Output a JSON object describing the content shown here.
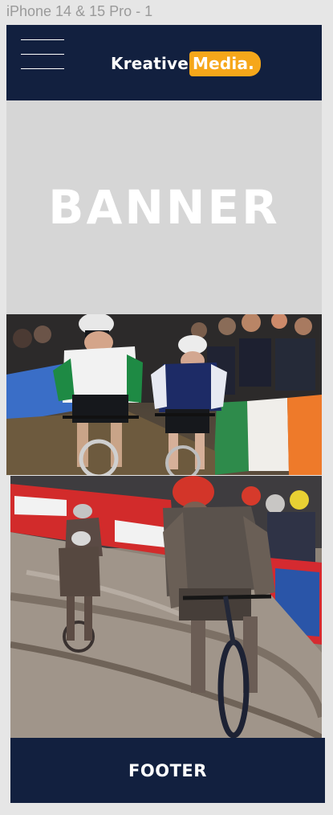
{
  "frame": {
    "label": "iPhone 14 & 15 Pro - 1"
  },
  "header": {
    "logo_primary": "Kreative",
    "logo_accent": "Media.",
    "menu_icon": "hamburger-menu-icon",
    "background_color": "#12203f",
    "accent_color": "#f6a71a"
  },
  "banner": {
    "text": "BANNER",
    "background_color": "#d6d6d6"
  },
  "photos": [
    {
      "name": "cyclocross-race-photo",
      "subject": "two cyclists riding past crowd with Italian flag"
    },
    {
      "name": "muddy-cyclist-photo",
      "subject": "muddy cyclist descending beside Bingoal barriers"
    }
  ],
  "footer": {
    "text": "FOOTER",
    "background_color": "#12203f"
  }
}
